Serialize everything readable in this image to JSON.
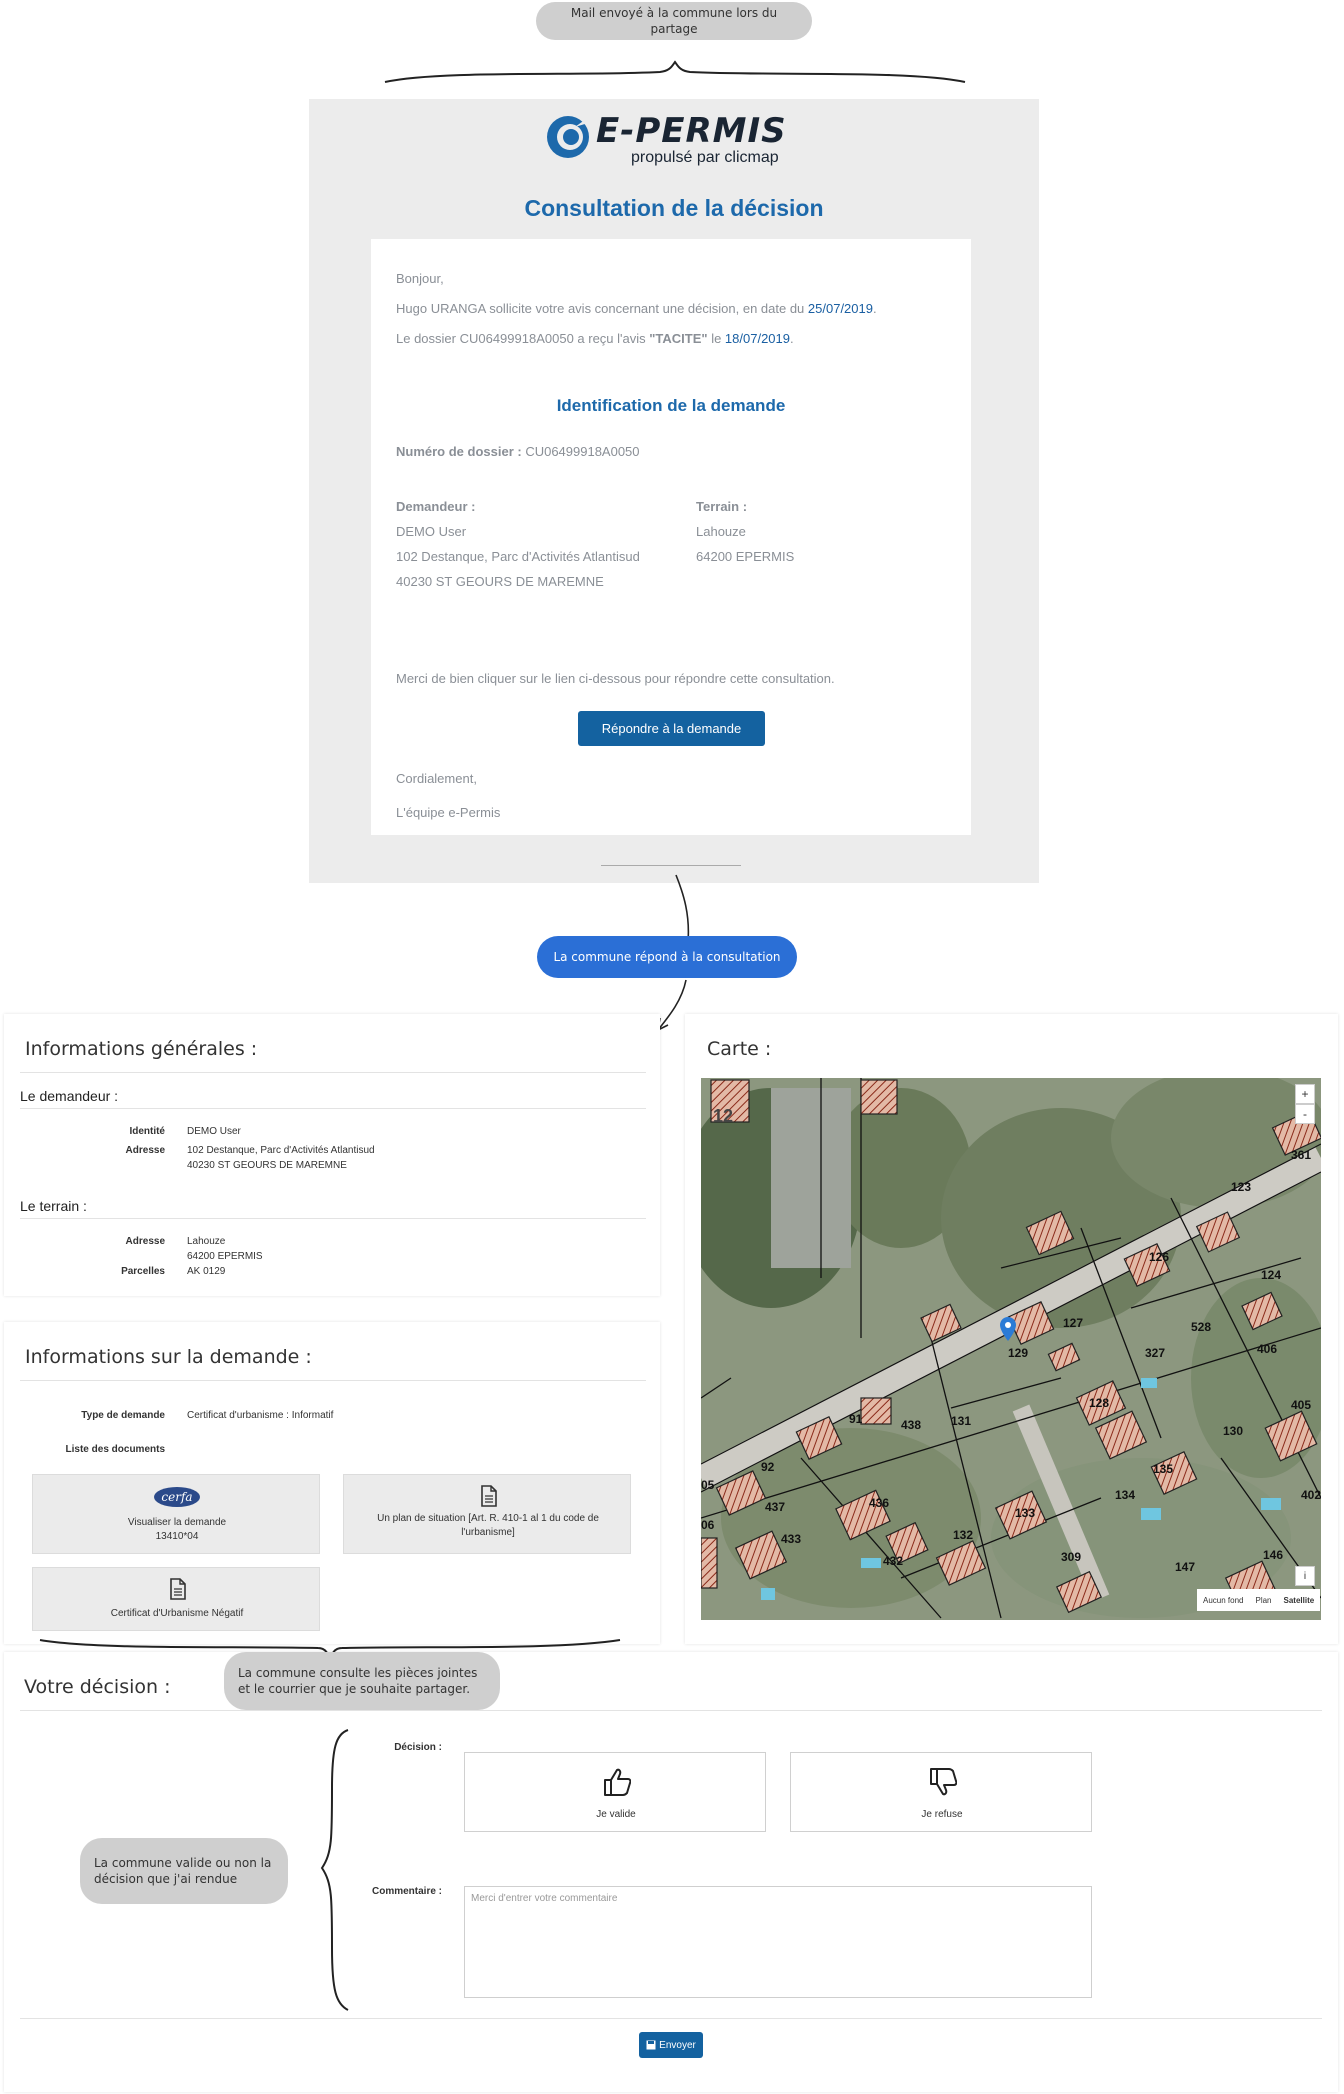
{
  "annotations": {
    "mail_sent": "Mail envoyé à la commune lors du partage",
    "commune_responds": "La commune répond à la consultation",
    "consults_docs": "La commune consulte les pièces jointes et le courrier que je souhaite partager.",
    "validates": "La commune valide ou non la décision que j'ai rendue"
  },
  "email": {
    "brand": "E-PERMIS",
    "brand_sub": "propulsé par clicmap",
    "title": "Consultation de la décision",
    "greeting": "Bonjour,",
    "line1_prefix": "Hugo URANGA sollicite votre avis concernant une décision, en date du ",
    "line1_date": "25/07/2019",
    "line1_suffix": ".",
    "line2_prefix": "Le dossier CU06499918A0050 a reçu l'avis ",
    "line2_avis": "\"TACITE\"",
    "line2_mid": " le ",
    "line2_date": "18/07/2019",
    "line2_suffix": ".",
    "section_title": "Identification de la demande",
    "dossier_label": "Numéro de dossier : ",
    "dossier_value": "CU06499918A0050",
    "demandeur_label": "Demandeur :",
    "demandeur_lines": [
      "DEMO User",
      "102 Destanque, Parc d'Activités Atlantisud",
      "40230 ST GEOURS DE MAREMNE"
    ],
    "terrain_label": "Terrain :",
    "terrain_lines": [
      "Lahouze",
      "64200 EPERMIS"
    ],
    "instructions": "Merci de bien cliquer sur le lien ci-dessous pour répondre cette consultation.",
    "button": "Répondre à la demande",
    "closing": "Cordialement,",
    "signature": "L'équipe e-Permis"
  },
  "general": {
    "title": "Informations générales :",
    "demandeur_title": "Le demandeur :",
    "identite_label": "Identité",
    "identite_value": "DEMO User",
    "adresse_label": "Adresse",
    "adresse_lines": [
      "102 Destanque, Parc d'Activités Atlantisud",
      "40230 ST GEOURS DE MAREMNE"
    ],
    "terrain_title": "Le terrain :",
    "terrain_adresse_label": "Adresse",
    "terrain_adresse_lines": [
      "Lahouze",
      "64200 EPERMIS"
    ],
    "parcelles_label": "Parcelles",
    "parcelles_value": "AK 0129"
  },
  "demande": {
    "title": "Informations sur la demande :",
    "type_label": "Type de demande",
    "type_value": "Certificat d'urbanisme : Informatif",
    "docs_label": "Liste des documents",
    "doc1_logo": "cerfa",
    "doc1_line1": "Visualiser la demande",
    "doc1_line2": "13410*04",
    "doc2_line1": "Un plan de situation [Art. R. 410-1 al 1 du code de",
    "doc2_line2": "l'urbanisme]",
    "doc3": "Certificat d'Urbanisme Négatif"
  },
  "map": {
    "title": "Carte :",
    "zoom_in": "+",
    "zoom_out": "-",
    "info": "i",
    "layers": [
      "Aucun fond",
      "Plan",
      "Satellite"
    ],
    "parcel_labels": [
      "12",
      "123",
      "126",
      "124",
      "127",
      "129",
      "528",
      "327",
      "406",
      "128",
      "131",
      "91",
      "438",
      "130",
      "405",
      "92",
      "135",
      "134",
      "436",
      "133",
      "437",
      "433",
      "132",
      "432",
      "309",
      "147",
      "146",
      "402",
      "05",
      "06",
      "361"
    ]
  },
  "decision": {
    "title": "Votre décision :",
    "decision_label": "Décision :",
    "valid": "Je valide",
    "refuse": "Je refuse",
    "comment_label": "Commentaire :",
    "comment_placeholder": "Merci d'entrer votre commentaire",
    "send": "Envoyer"
  },
  "icons": {
    "doc": "document-icon",
    "thumb_up": "thumb-up-icon",
    "thumb_down": "thumb-down-icon",
    "save": "floppy-icon",
    "pin": "map-pin-icon"
  },
  "colors": {
    "brand_blue": "#1d69ab",
    "button_blue": "#1462a0",
    "bubble_blue": "#2b6fd6",
    "bubble_grey": "#cfcfcf"
  }
}
